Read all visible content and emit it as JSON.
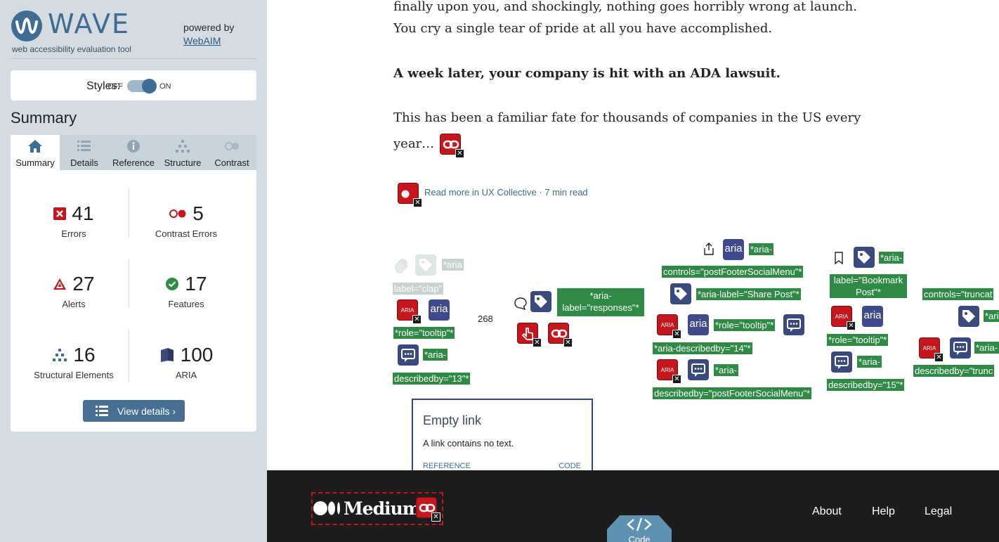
{
  "wave": {
    "brand": {
      "name": "WAVE",
      "tagline": "web accessibility evaluation tool",
      "powered_by": "powered by",
      "webaim": "WebAIM"
    },
    "styles": {
      "label": "Styles:",
      "off": "OFF",
      "on": "ON",
      "state": "on"
    },
    "summary_heading": "Summary",
    "tabs": [
      {
        "label": "Summary",
        "icon": "home-icon",
        "active": true
      },
      {
        "label": "Details",
        "icon": "list-icon"
      },
      {
        "label": "Reference",
        "icon": "info-icon"
      },
      {
        "label": "Structure",
        "icon": "hierarchy-icon"
      },
      {
        "label": "Contrast",
        "icon": "contrast-icon"
      }
    ],
    "stats": {
      "errors": {
        "count": "41",
        "label": "Errors"
      },
      "contrast": {
        "count": "5",
        "label": "Contrast Errors"
      },
      "alerts": {
        "count": "27",
        "label": "Alerts"
      },
      "features": {
        "count": "17",
        "label": "Features"
      },
      "structural": {
        "count": "16",
        "label": "Structural Elements"
      },
      "aria": {
        "count": "100",
        "label": "ARIA"
      }
    },
    "view_details": "View details ›",
    "colors": {
      "error": "#c4161c",
      "accent": "#466f93",
      "feature": "#2e8a44"
    }
  },
  "article": {
    "line1": "finally upon you, and shockingly, nothing goes horribly wrong at launch.",
    "line2": "You cry a single tear of pride at all you have accomplished.",
    "bold_line": "A week later, your company is hit with an ADA lawsuit.",
    "line3": "This has been a familiar fate for thousands of companies in the US every",
    "line4": "year…",
    "read_more": "Read more in UX Collective · 7 min read"
  },
  "annotations": {
    "aria_small": "ARIA",
    "aria_indicator": "aria",
    "clap_count": "268",
    "labels": {
      "clap_a": "*aria",
      "clap_b": "label=\"clap\"",
      "tooltip_role_1": "*role=\"tooltip\"*",
      "describedby_13_a": "*aria-",
      "describedby_13_b": "describedby=\"13\"*",
      "responses_a": "*aria-",
      "responses_b": "label=\"responses\"*",
      "share_controls_a": "*aria-",
      "share_controls_b": "controls=\"postFooterSocialMenu\"*",
      "share_label": "*aria-label=\"Share Post\"*",
      "tooltip_role_2": "*role=\"tooltip\"*",
      "describedby_14": "*aria-describedby=\"14\"*",
      "social_menu_a": "*aria-",
      "social_menu_b": "describedby=\"postFooterSocialMenu\"*",
      "bookmark_a": "*aria-",
      "bookmark_b": "label=\"Bookmark",
      "bookmark_c": "Post\"*",
      "tooltip_role_3": "*role=\"tooltip\"*",
      "describedby_15_a": "*aria-",
      "describedby_15_b": "describedby=\"15\"*",
      "truncate_controls": "controls=\"truncat",
      "truncate_aria": "*ari",
      "truncate_describedby_a": "*aria-",
      "truncate_describedby_b": "describedby=\"trunc"
    }
  },
  "tooltip": {
    "title": "Empty link",
    "body": "A link contains no text.",
    "reference": "REFERENCE",
    "code": "CODE"
  },
  "footer": {
    "brand": "Medium",
    "links": [
      "About",
      "Help",
      "Legal"
    ],
    "code_badge": "Code"
  }
}
